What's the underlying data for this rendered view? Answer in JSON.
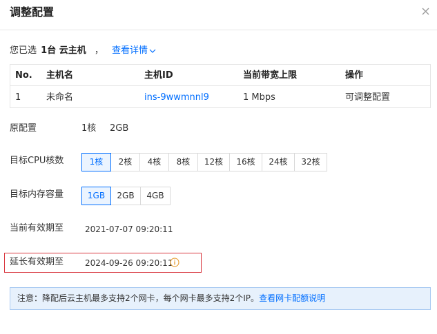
{
  "dialog": {
    "title": "调整配置",
    "close_icon": "close-icon"
  },
  "selection": {
    "prefix": "您已选",
    "count": "1台 云主机",
    "separator": "，",
    "details_link": "查看详情"
  },
  "table": {
    "headers": [
      "No.",
      "主机名",
      "主机ID",
      "当前带宽上限",
      "操作"
    ],
    "rows": [
      [
        "1",
        "未命名",
        "ins-9wwmnnl9",
        "1 Mbps",
        "可调整配置"
      ]
    ]
  },
  "original_config": {
    "label": "原配置",
    "cpu": "1核",
    "memory": "2GB"
  },
  "target_cpu": {
    "label": "目标CPU核数",
    "options": [
      "1核",
      "2核",
      "4核",
      "8核",
      "12核",
      "16核",
      "24核",
      "32核"
    ],
    "selected": "1核"
  },
  "target_memory": {
    "label": "目标内存容量",
    "options": [
      "1GB",
      "2GB",
      "4GB"
    ],
    "selected": "1GB"
  },
  "current_expiry": {
    "label": "当前有效期至",
    "value": "2021-07-07 09:20:11"
  },
  "extended_expiry": {
    "label": "延长有效期至",
    "value": "2024-09-26 09:20:11",
    "icon": "info-icon"
  },
  "notice": {
    "text": "注意：降配后云主机最多支持2个网卡，每个网卡最多支持2个IP。",
    "link": "查看网卡配额说明"
  },
  "colors": {
    "accent": "#006eff",
    "highlight_border": "#d9363e",
    "notice_bg": "#e7f1fc",
    "warning_icon": "#e8a33d"
  }
}
